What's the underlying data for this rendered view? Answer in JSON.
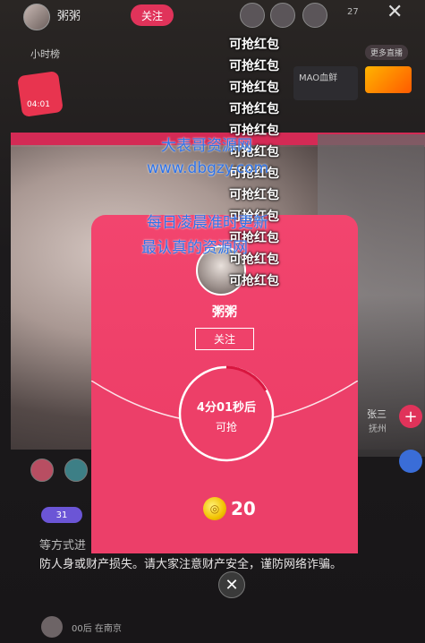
{
  "host": {
    "name": "粥粥",
    "sub": "",
    "follow_label": "关注"
  },
  "top": {
    "viewer_count": "27",
    "close_icon": "✕",
    "rank_label": "小时榜",
    "more_label": "更多直播"
  },
  "pk": {
    "title": "MAO血鲜",
    "sub": ""
  },
  "gift": {
    "timer": "04:01"
  },
  "packets": [
    "可抢红包",
    "可抢红包",
    "可抢红包",
    "可抢红包",
    "可抢红包",
    "可抢红包",
    "可抢红包",
    "可抢红包",
    "可抢红包",
    "可抢红包",
    "可抢红包",
    "可抢红包"
  ],
  "watermark": {
    "line1": "大表哥资源网",
    "line2": "www.dbgzy.com",
    "line3": "每日凌晨准时更新",
    "line4": "最认真的资源网"
  },
  "modal": {
    "name": "粥粥",
    "follow_label": "关注",
    "countdown": "4分01秒后",
    "countdown_sub": "可抢",
    "coin_amount": "20",
    "close_icon": "✕",
    "accent": "#f2456e"
  },
  "notice": {
    "prefix": "等方式进",
    "text": "防人身或财产损失。请大家注意财产安全，谨防网络诈骗。"
  },
  "bottom": {
    "text": "00后    在南京"
  },
  "fan_badge": "31",
  "user_chip": {
    "name": "张三",
    "city": "抚州",
    "add_icon": "+"
  }
}
